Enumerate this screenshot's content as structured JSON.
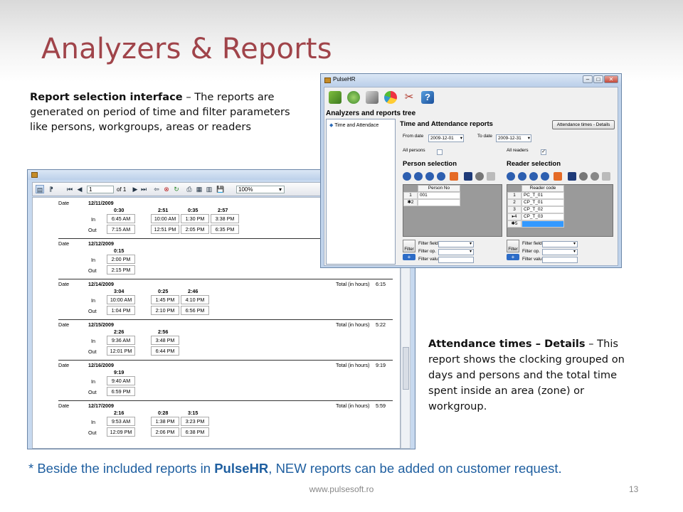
{
  "slide": {
    "title": "Analyzers & Reports",
    "desc1_bold": "Report selection interface",
    "desc1_text": " – The reports are generated on period of time and filter parameters like persons, workgroups, areas or readers",
    "desc2_bold": "Attendance times – Details",
    "desc2_text": " – This report shows the clocking grouped on days and persons and the total time spent inside an area (zone) or workgroup.",
    "footnote_pre": "* Beside the included reports in ",
    "footnote_brand": "PulseHR",
    "footnote_post": ", NEW reports can be added on customer request.",
    "footer_url": "www.pulsesoft.ro",
    "page_number": "13"
  },
  "report_viewer": {
    "toolbar": {
      "page_value": "1",
      "page_of": "of 1",
      "zoom": "100%"
    },
    "labels": {
      "date": "Date",
      "in": "In",
      "out": "Out",
      "total": "Total (in hours)"
    },
    "groups": [
      {
        "date": "12/11/2009",
        "total": "",
        "dur": [
          "0:30",
          "2:51",
          "0:35",
          "2:57"
        ],
        "in": [
          "6:45 AM",
          "10:00 AM",
          "1:30 PM",
          "3:38 PM"
        ],
        "out": [
          "7:15 AM",
          "12:51 PM",
          "2:05 PM",
          "6:35 PM"
        ]
      },
      {
        "date": "12/12/2009",
        "total": "",
        "dur": [
          "0:15"
        ],
        "in": [
          "2:00 PM"
        ],
        "out": [
          "2:15 PM"
        ]
      },
      {
        "date": "12/14/2009",
        "total": "6:15",
        "dur": [
          "3:04",
          "0:25",
          "2:46"
        ],
        "in": [
          "10:00 AM",
          "1:45 PM",
          "4:10 PM"
        ],
        "out": [
          "1:04 PM",
          "2:10 PM",
          "6:56 PM"
        ]
      },
      {
        "date": "12/15/2009",
        "total": "5:22",
        "dur": [
          "2:26",
          "2:56"
        ],
        "in": [
          "9:36 AM",
          "3:48 PM"
        ],
        "out": [
          "12:01 PM",
          "6:44 PM"
        ]
      },
      {
        "date": "12/16/2009",
        "total": "9:19",
        "dur": [
          "9:19"
        ],
        "in": [
          "9:40 AM"
        ],
        "out": [
          "6:59 PM"
        ]
      },
      {
        "date": "12/17/2009",
        "total": "5:59",
        "dur": [
          "2:16",
          "0:28",
          "3:15"
        ],
        "in": [
          "9:53 AM",
          "1:38 PM",
          "3:23 PM"
        ],
        "out": [
          "12:09 PM",
          "2:06 PM",
          "6:38 PM"
        ]
      }
    ]
  },
  "pulse_window": {
    "title": "PulseHR",
    "tree_header": "Analyzers and reports tree",
    "tree_item": "Time and Attendace",
    "panel_header": "Time and Attendance reports",
    "report_button": "Attendance times - Details",
    "from_date_label": "From date",
    "from_date": "2009-12-01",
    "to_date_label": "To date",
    "to_date": "2009-12-31",
    "all_persons_label": "All persons",
    "all_readers_label": "All readers",
    "person_selection": "Person selection",
    "reader_selection": "Reader selection",
    "person_col": "Person No",
    "person_rows": [
      {
        "n": "1",
        "v": "001"
      },
      {
        "n": "2",
        "v": ""
      }
    ],
    "reader_col": "Reader code",
    "reader_rows": [
      {
        "n": "1",
        "v": "PC_T_01"
      },
      {
        "n": "2",
        "v": "CP_T_01"
      },
      {
        "n": "3",
        "v": "CP_T_02"
      },
      {
        "n": "4",
        "v": "CP_T_03"
      },
      {
        "n": "5",
        "v": ""
      }
    ],
    "filter_button": "Filter",
    "filter_field": "Filter field",
    "filter_op": "Filter op.",
    "filter_value": "Filter value"
  }
}
